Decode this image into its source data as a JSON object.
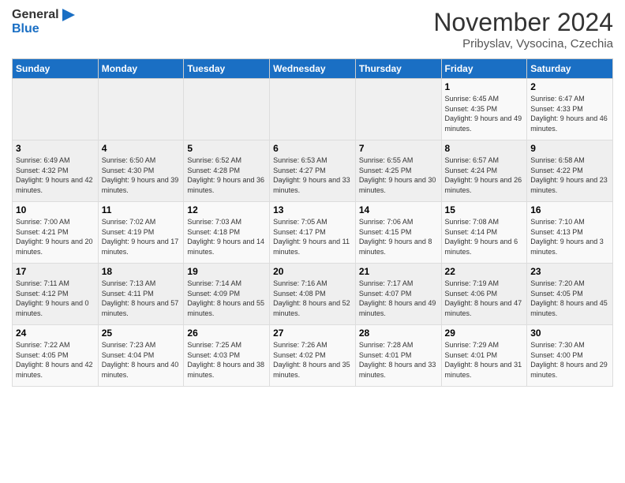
{
  "header": {
    "logo_general": "General",
    "logo_blue": "Blue",
    "month": "November 2024",
    "location": "Pribyslav, Vysocina, Czechia"
  },
  "weekdays": [
    "Sunday",
    "Monday",
    "Tuesday",
    "Wednesday",
    "Thursday",
    "Friday",
    "Saturday"
  ],
  "weeks": [
    [
      {
        "day": "",
        "info": ""
      },
      {
        "day": "",
        "info": ""
      },
      {
        "day": "",
        "info": ""
      },
      {
        "day": "",
        "info": ""
      },
      {
        "day": "",
        "info": ""
      },
      {
        "day": "1",
        "info": "Sunrise: 6:45 AM\nSunset: 4:35 PM\nDaylight: 9 hours and 49 minutes."
      },
      {
        "day": "2",
        "info": "Sunrise: 6:47 AM\nSunset: 4:33 PM\nDaylight: 9 hours and 46 minutes."
      }
    ],
    [
      {
        "day": "3",
        "info": "Sunrise: 6:49 AM\nSunset: 4:32 PM\nDaylight: 9 hours and 42 minutes."
      },
      {
        "day": "4",
        "info": "Sunrise: 6:50 AM\nSunset: 4:30 PM\nDaylight: 9 hours and 39 minutes."
      },
      {
        "day": "5",
        "info": "Sunrise: 6:52 AM\nSunset: 4:28 PM\nDaylight: 9 hours and 36 minutes."
      },
      {
        "day": "6",
        "info": "Sunrise: 6:53 AM\nSunset: 4:27 PM\nDaylight: 9 hours and 33 minutes."
      },
      {
        "day": "7",
        "info": "Sunrise: 6:55 AM\nSunset: 4:25 PM\nDaylight: 9 hours and 30 minutes."
      },
      {
        "day": "8",
        "info": "Sunrise: 6:57 AM\nSunset: 4:24 PM\nDaylight: 9 hours and 26 minutes."
      },
      {
        "day": "9",
        "info": "Sunrise: 6:58 AM\nSunset: 4:22 PM\nDaylight: 9 hours and 23 minutes."
      }
    ],
    [
      {
        "day": "10",
        "info": "Sunrise: 7:00 AM\nSunset: 4:21 PM\nDaylight: 9 hours and 20 minutes."
      },
      {
        "day": "11",
        "info": "Sunrise: 7:02 AM\nSunset: 4:19 PM\nDaylight: 9 hours and 17 minutes."
      },
      {
        "day": "12",
        "info": "Sunrise: 7:03 AM\nSunset: 4:18 PM\nDaylight: 9 hours and 14 minutes."
      },
      {
        "day": "13",
        "info": "Sunrise: 7:05 AM\nSunset: 4:17 PM\nDaylight: 9 hours and 11 minutes."
      },
      {
        "day": "14",
        "info": "Sunrise: 7:06 AM\nSunset: 4:15 PM\nDaylight: 9 hours and 8 minutes."
      },
      {
        "day": "15",
        "info": "Sunrise: 7:08 AM\nSunset: 4:14 PM\nDaylight: 9 hours and 6 minutes."
      },
      {
        "day": "16",
        "info": "Sunrise: 7:10 AM\nSunset: 4:13 PM\nDaylight: 9 hours and 3 minutes."
      }
    ],
    [
      {
        "day": "17",
        "info": "Sunrise: 7:11 AM\nSunset: 4:12 PM\nDaylight: 9 hours and 0 minutes."
      },
      {
        "day": "18",
        "info": "Sunrise: 7:13 AM\nSunset: 4:11 PM\nDaylight: 8 hours and 57 minutes."
      },
      {
        "day": "19",
        "info": "Sunrise: 7:14 AM\nSunset: 4:09 PM\nDaylight: 8 hours and 55 minutes."
      },
      {
        "day": "20",
        "info": "Sunrise: 7:16 AM\nSunset: 4:08 PM\nDaylight: 8 hours and 52 minutes."
      },
      {
        "day": "21",
        "info": "Sunrise: 7:17 AM\nSunset: 4:07 PM\nDaylight: 8 hours and 49 minutes."
      },
      {
        "day": "22",
        "info": "Sunrise: 7:19 AM\nSunset: 4:06 PM\nDaylight: 8 hours and 47 minutes."
      },
      {
        "day": "23",
        "info": "Sunrise: 7:20 AM\nSunset: 4:05 PM\nDaylight: 8 hours and 45 minutes."
      }
    ],
    [
      {
        "day": "24",
        "info": "Sunrise: 7:22 AM\nSunset: 4:05 PM\nDaylight: 8 hours and 42 minutes."
      },
      {
        "day": "25",
        "info": "Sunrise: 7:23 AM\nSunset: 4:04 PM\nDaylight: 8 hours and 40 minutes."
      },
      {
        "day": "26",
        "info": "Sunrise: 7:25 AM\nSunset: 4:03 PM\nDaylight: 8 hours and 38 minutes."
      },
      {
        "day": "27",
        "info": "Sunrise: 7:26 AM\nSunset: 4:02 PM\nDaylight: 8 hours and 35 minutes."
      },
      {
        "day": "28",
        "info": "Sunrise: 7:28 AM\nSunset: 4:01 PM\nDaylight: 8 hours and 33 minutes."
      },
      {
        "day": "29",
        "info": "Sunrise: 7:29 AM\nSunset: 4:01 PM\nDaylight: 8 hours and 31 minutes."
      },
      {
        "day": "30",
        "info": "Sunrise: 7:30 AM\nSunset: 4:00 PM\nDaylight: 8 hours and 29 minutes."
      }
    ]
  ]
}
